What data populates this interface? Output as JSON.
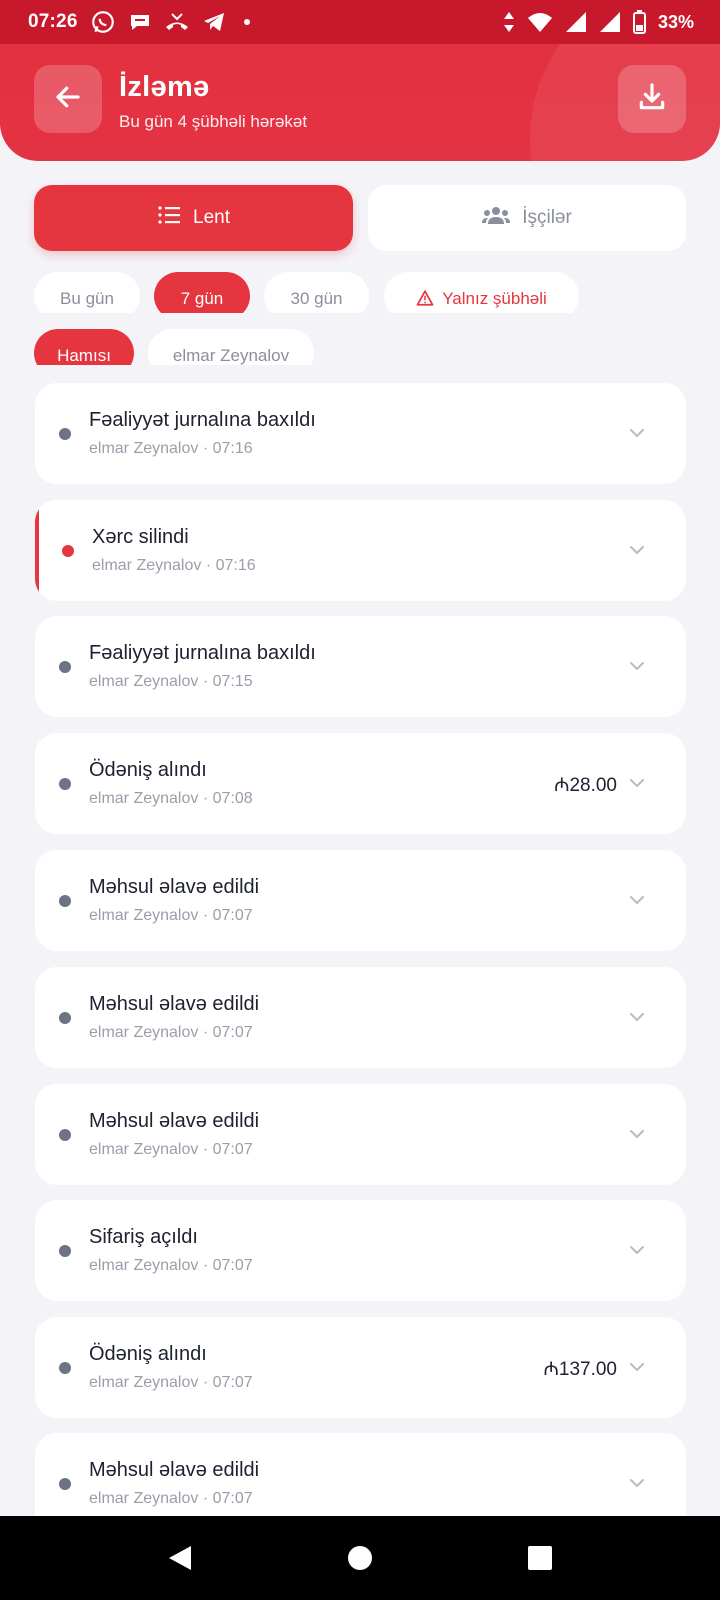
{
  "status_bar": {
    "time": "07:26",
    "battery": "33%",
    "left_icons": [
      "whatsapp-icon",
      "chat-bubble-icon",
      "missed-call-icon",
      "telegram-icon"
    ],
    "right_icons": [
      "data-arrows-icon",
      "wifi-icon",
      "signal-icon",
      "signal-icon",
      "battery-icon"
    ]
  },
  "header": {
    "title": "İzləmə",
    "subtitle": "Bu gün 4 şübhəli hərəkət",
    "back_icon": "arrow-left-icon",
    "download_icon": "download-icon"
  },
  "tabs": [
    {
      "label": "Lent",
      "icon": "list-icon",
      "active": true
    },
    {
      "label": "İşçilər",
      "icon": "users-icon",
      "active": false
    }
  ],
  "period_filters": [
    {
      "label": "Bu gün",
      "active": false
    },
    {
      "label": "7 gün",
      "active": true
    },
    {
      "label": "30 gün",
      "active": false
    },
    {
      "label": "Yalnız şübhəli",
      "active": false,
      "icon": "warning-icon"
    }
  ],
  "user_filters": [
    {
      "label": "Hamısı",
      "active": true
    },
    {
      "label": "elmar Zeynalov",
      "active": false
    }
  ],
  "activities": [
    {
      "title": "Fəaliyyət jurnalına baxıldı",
      "meta": "elmar Zeynalov · 07:16",
      "amount": "",
      "flagged": false
    },
    {
      "title": "Xərc silindi",
      "meta": "elmar Zeynalov · 07:16",
      "amount": "",
      "flagged": true
    },
    {
      "title": "Fəaliyyət jurnalına baxıldı",
      "meta": "elmar Zeynalov · 07:15",
      "amount": "",
      "flagged": false
    },
    {
      "title": "Ödəniş alındı",
      "meta": "elmar Zeynalov · 07:08",
      "amount": "₼28.00",
      "flagged": false
    },
    {
      "title": "Məhsul əlavə edildi",
      "meta": "elmar Zeynalov · 07:07",
      "amount": "",
      "flagged": false
    },
    {
      "title": "Məhsul əlavə edildi",
      "meta": "elmar Zeynalov · 07:07",
      "amount": "",
      "flagged": false
    },
    {
      "title": "Məhsul əlavə edildi",
      "meta": "elmar Zeynalov · 07:07",
      "amount": "",
      "flagged": false
    },
    {
      "title": "Sifariş açıldı",
      "meta": "elmar Zeynalov · 07:07",
      "amount": "",
      "flagged": false
    },
    {
      "title": "Ödəniş alındı",
      "meta": "elmar Zeynalov · 07:07",
      "amount": "₼137.00",
      "flagged": false
    },
    {
      "title": "Məhsul əlavə edildi",
      "meta": "elmar Zeynalov · 07:07",
      "amount": "",
      "flagged": false
    }
  ],
  "colors": {
    "accent": "#e5353f",
    "status_bar": "#c8192c",
    "background": "#f4f4f8",
    "dot_normal": "#6b7384"
  },
  "nav_bar": {
    "buttons": [
      "back-triangle-icon",
      "home-circle-icon",
      "recents-square-icon"
    ]
  }
}
